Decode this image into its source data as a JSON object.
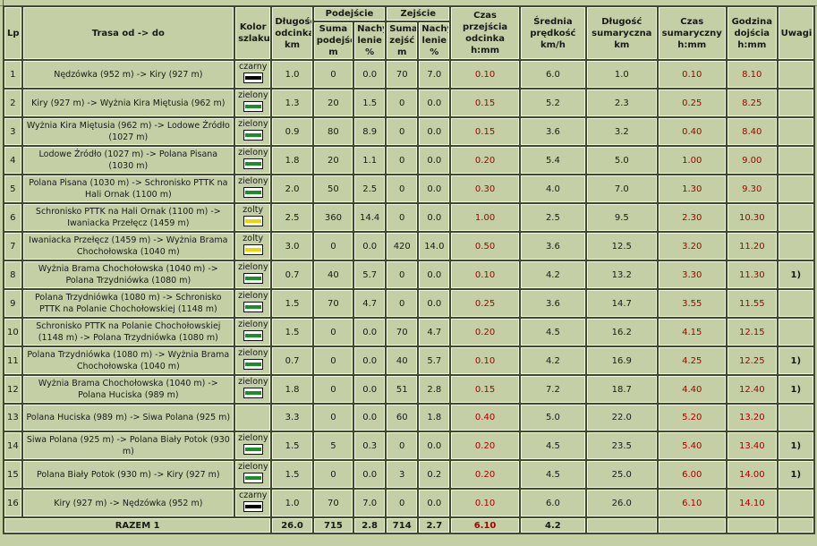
{
  "colors": {
    "bg": "#c4cfa6",
    "grid": "#3f4a2a",
    "time_text": "#a80000",
    "blaze_czarny": "#000000",
    "blaze_zielony": "#1e8c2a",
    "blaze_zolty": "#f0d400"
  },
  "headers": {
    "lp": "Lp",
    "trasa": "Trasa od -> do",
    "kolor": "Kolor szlaku",
    "dlugosc_odcinka": "Długość odcinka km",
    "podejscie": "Podejście",
    "suma_podejsc": "Suma podejść m",
    "nachylenie_pod": "Nachy lenie %",
    "zejscie": "Zejście",
    "suma_zejsc": "Suma zejść m",
    "nachylenie_zej": "Nachy lenie %",
    "czas_przejscia": "Czas przejścia odcinka h:mm",
    "srednia_predkosc": "Średnia prędkość km/h",
    "dlugosc_sumaryczna": "Długość sumaryczna km",
    "czas_sumaryczny": "Czas sumaryczny h:mm",
    "godzina_dojscia": "Godzina dojścia h:mm",
    "uwagi": "Uwagi"
  },
  "rows": [
    {
      "lp": "1",
      "trasa": "Nędzówka (952 m) -> Kiry (927 m)",
      "kolor": "czarny",
      "blaze": "czarny",
      "dl": "1.0",
      "pod": "0",
      "npod": "0.0",
      "zej": "70",
      "nzej": "7.0",
      "czas": "0.10",
      "v": "6.0",
      "dlsum": "1.0",
      "czsum": "0.10",
      "godz": "8.10",
      "uwagi": ""
    },
    {
      "lp": "2",
      "trasa": "Kiry (927 m) -> Wyżnia Kira Miętusia (962 m)",
      "kolor": "zielony",
      "blaze": "zielony",
      "dl": "1.3",
      "pod": "20",
      "npod": "1.5",
      "zej": "0",
      "nzej": "0.0",
      "czas": "0.15",
      "v": "5.2",
      "dlsum": "2.3",
      "czsum": "0.25",
      "godz": "8.25",
      "uwagi": ""
    },
    {
      "lp": "3",
      "trasa": "Wyżnia Kira Miętusia (962 m) -> Lodowe Źródło (1027 m)",
      "kolor": "zielony",
      "blaze": "zielony",
      "dl": "0.9",
      "pod": "80",
      "npod": "8.9",
      "zej": "0",
      "nzej": "0.0",
      "czas": "0.15",
      "v": "3.6",
      "dlsum": "3.2",
      "czsum": "0.40",
      "godz": "8.40",
      "uwagi": ""
    },
    {
      "lp": "4",
      "trasa": "Lodowe Źródło (1027 m) -> Polana Pisana (1030 m)",
      "kolor": "zielony",
      "blaze": "zielony",
      "dl": "1.8",
      "pod": "20",
      "npod": "1.1",
      "zej": "0",
      "nzej": "0.0",
      "czas": "0.20",
      "v": "5.4",
      "dlsum": "5.0",
      "czsum": "1.00",
      "godz": "9.00",
      "uwagi": ""
    },
    {
      "lp": "5",
      "trasa": "Polana Pisana (1030 m) -> Schronisko PTTK na Hali Ornak (1100 m)",
      "kolor": "zielony",
      "blaze": "zielony",
      "dl": "2.0",
      "pod": "50",
      "npod": "2.5",
      "zej": "0",
      "nzej": "0.0",
      "czas": "0.30",
      "v": "4.0",
      "dlsum": "7.0",
      "czsum": "1.30",
      "godz": "9.30",
      "uwagi": ""
    },
    {
      "lp": "6",
      "trasa": "Schronisko PTTK na Hali Ornak (1100 m) -> Iwaniacka Przełęcz (1459 m)",
      "kolor": "zolty",
      "blaze": "zolty",
      "dl": "2.5",
      "pod": "360",
      "npod": "14.4",
      "zej": "0",
      "nzej": "0.0",
      "czas": "1.00",
      "v": "2.5",
      "dlsum": "9.5",
      "czsum": "2.30",
      "godz": "10.30",
      "uwagi": ""
    },
    {
      "lp": "7",
      "trasa": "Iwaniacka Przełęcz (1459 m) -> Wyżnia Brama Chochołowska (1040 m)",
      "kolor": "zolty",
      "blaze": "zolty",
      "dl": "3.0",
      "pod": "0",
      "npod": "0.0",
      "zej": "420",
      "nzej": "14.0",
      "czas": "0.50",
      "v": "3.6",
      "dlsum": "12.5",
      "czsum": "3.20",
      "godz": "11.20",
      "uwagi": ""
    },
    {
      "lp": "8",
      "trasa": "Wyżnia Brama Chochołowska (1040 m) -> Polana Trzydniówka (1080 m)",
      "kolor": "zielony",
      "blaze": "zielony",
      "dl": "0.7",
      "pod": "40",
      "npod": "5.7",
      "zej": "0",
      "nzej": "0.0",
      "czas": "0.10",
      "v": "4.2",
      "dlsum": "13.2",
      "czsum": "3.30",
      "godz": "11.30",
      "uwagi": "1)"
    },
    {
      "lp": "9",
      "trasa": "Polana Trzydniówka (1080 m) -> Schronisko PTTK na Polanie Chochołowskiej (1148 m)",
      "kolor": "zielony",
      "blaze": "zielony",
      "dl": "1.5",
      "pod": "70",
      "npod": "4.7",
      "zej": "0",
      "nzej": "0.0",
      "czas": "0.25",
      "v": "3.6",
      "dlsum": "14.7",
      "czsum": "3.55",
      "godz": "11.55",
      "uwagi": ""
    },
    {
      "lp": "10",
      "trasa": "Schronisko PTTK na Polanie Chochołowskiej (1148 m) -> Polana Trzydniówka (1080 m)",
      "kolor": "zielony",
      "blaze": "zielony",
      "dl": "1.5",
      "pod": "0",
      "npod": "0.0",
      "zej": "70",
      "nzej": "4.7",
      "czas": "0.20",
      "v": "4.5",
      "dlsum": "16.2",
      "czsum": "4.15",
      "godz": "12.15",
      "uwagi": ""
    },
    {
      "lp": "11",
      "trasa": "Polana Trzydniówka (1080 m) -> Wyżnia Brama Chochołowska (1040 m)",
      "kolor": "zielony",
      "blaze": "zielony",
      "dl": "0.7",
      "pod": "0",
      "npod": "0.0",
      "zej": "40",
      "nzej": "5.7",
      "czas": "0.10",
      "v": "4.2",
      "dlsum": "16.9",
      "czsum": "4.25",
      "godz": "12.25",
      "uwagi": "1)"
    },
    {
      "lp": "12",
      "trasa": "Wyżnia Brama Chochołowska (1040 m) -> Polana Huciska (989 m)",
      "kolor": "zielony",
      "blaze": "zielony",
      "dl": "1.8",
      "pod": "0",
      "npod": "0.0",
      "zej": "51",
      "nzej": "2.8",
      "czas": "0.15",
      "v": "7.2",
      "dlsum": "18.7",
      "czsum": "4.40",
      "godz": "12.40",
      "uwagi": "1)"
    },
    {
      "lp": "13",
      "trasa": "Polana Huciska (989 m) -> Siwa Polana (925 m)",
      "kolor": "",
      "blaze": "",
      "dl": "3.3",
      "pod": "0",
      "npod": "0.0",
      "zej": "60",
      "nzej": "1.8",
      "czas": "0.40",
      "v": "5.0",
      "dlsum": "22.0",
      "czsum": "5.20",
      "godz": "13.20",
      "uwagi": ""
    },
    {
      "lp": "14",
      "trasa": "Siwa Polana (925 m) -> Polana Biały Potok (930 m)",
      "kolor": "zielony",
      "blaze": "zielony",
      "dl": "1.5",
      "pod": "5",
      "npod": "0.3",
      "zej": "0",
      "nzej": "0.0",
      "czas": "0.20",
      "v": "4.5",
      "dlsum": "23.5",
      "czsum": "5.40",
      "godz": "13.40",
      "uwagi": "1)"
    },
    {
      "lp": "15",
      "trasa": "Polana Biały Potok (930 m) -> Kiry (927 m)",
      "kolor": "zielony",
      "blaze": "zielony",
      "dl": "1.5",
      "pod": "0",
      "npod": "0.0",
      "zej": "3",
      "nzej": "0.2",
      "czas": "0.20",
      "v": "4.5",
      "dlsum": "25.0",
      "czsum": "6.00",
      "godz": "14.00",
      "uwagi": "1)"
    },
    {
      "lp": "16",
      "trasa": "Kiry (927 m) -> Nędzówka (952 m)",
      "kolor": "czarny",
      "blaze": "czarny",
      "dl": "1.0",
      "pod": "70",
      "npod": "7.0",
      "zej": "0",
      "nzej": "0.0",
      "czas": "0.10",
      "v": "6.0",
      "dlsum": "26.0",
      "czsum": "6.10",
      "godz": "14.10",
      "uwagi": ""
    }
  ],
  "totals": {
    "label": "RAZEM 1",
    "dl": "26.0",
    "pod": "715",
    "npod": "2.8",
    "zej": "714",
    "nzej": "2.7",
    "czas": "6.10",
    "v": "4.2"
  }
}
